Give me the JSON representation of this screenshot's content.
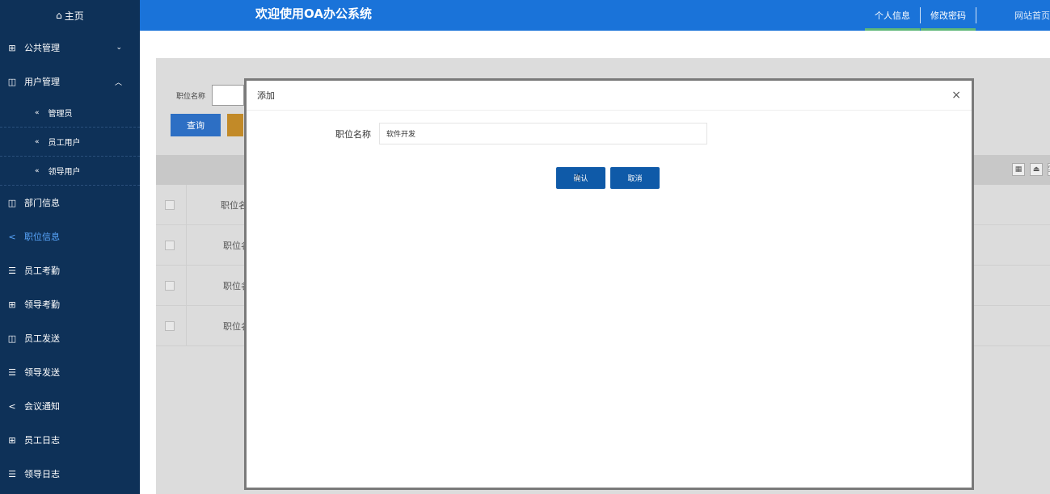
{
  "header": {
    "home_icon": "home-icon",
    "home_label": "主页",
    "title": "欢迎使用OA办公系统",
    "links": [
      "个人信息",
      "修改密码",
      "网站首页"
    ]
  },
  "sidebar": {
    "public_mgmt": "公共管理",
    "user_mgmt": "用户管理",
    "sub_admin": "管理员",
    "sub_staff": "员工用户",
    "sub_leader": "领导用户",
    "dept_info": "部门信息",
    "position_info": "职位信息",
    "staff_attendance": "员工考勤",
    "leader_attendance": "领导考勤",
    "staff_send": "员工发送",
    "leader_send": "领导发送",
    "meeting_notice": "会议通知",
    "staff_log": "员工日志",
    "leader_log": "领导日志"
  },
  "background": {
    "search_label": "职位名称",
    "query_button": "查询",
    "rows": [
      "职位名",
      "职位名",
      "职位名",
      "职位名"
    ]
  },
  "modal": {
    "title": "添加",
    "close": "×",
    "field_label": "职位名称",
    "field_value": "软件开发",
    "confirm_button": "确认",
    "cancel_button": "取消"
  },
  "colors": {
    "header_blue": "#1a73d9",
    "sidebar_navy": "#0e3158",
    "active_link": "#5aa8ff",
    "button_blue": "#0f5aa8"
  }
}
